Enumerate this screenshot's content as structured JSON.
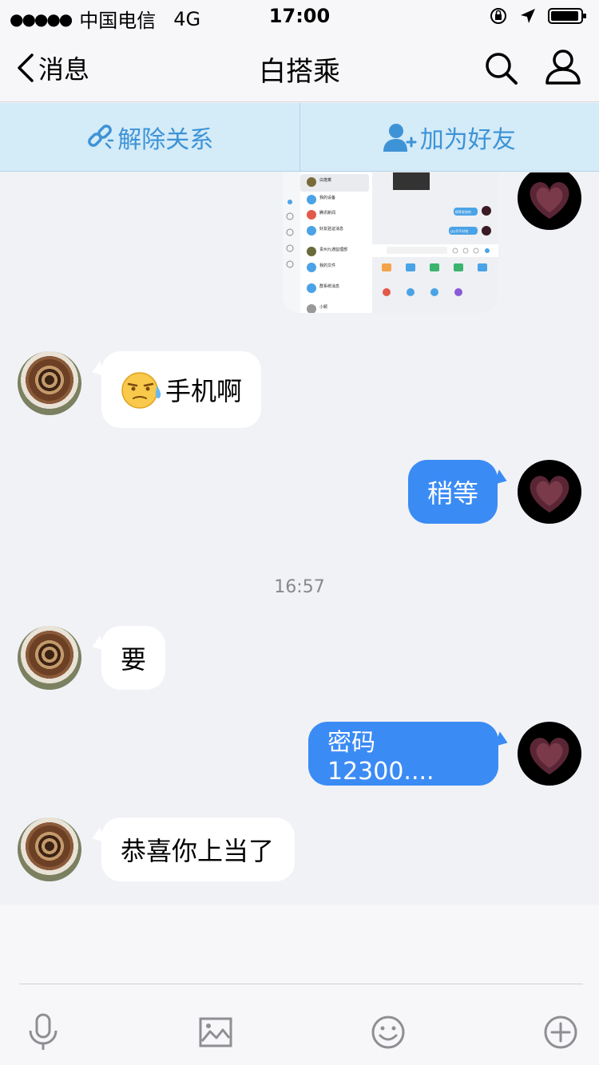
{
  "status_bar": {
    "signal": "●●●●●",
    "carrier": "中国电信",
    "network": "4G",
    "time": "17:00"
  },
  "nav": {
    "back_label": "消息",
    "title": "白搭乘"
  },
  "actions": {
    "unbind_label": "解除关系",
    "add_friend_label": "加为好友"
  },
  "messages": [
    {
      "side": "in",
      "text": "手机啊",
      "emoji": "sweat-emoji"
    },
    {
      "side": "out",
      "text": "稍等"
    },
    {
      "side": "in",
      "text": "要"
    },
    {
      "side": "out",
      "text": "密码12300...."
    },
    {
      "side": "in",
      "text": "恭喜你上当了"
    }
  ],
  "timestamp": "16:57",
  "shared_image": {
    "list_items": [
      "白搭乘",
      "我的设备",
      "腾讯新闻",
      "好友验证消息",
      "贵州九通监理部",
      "我的文件",
      "群系统消息",
      "小颖"
    ],
    "bubble_texts": [
      "稍等发给你",
      "QQ号不对哈"
    ]
  },
  "colors": {
    "accent": "#3b8bf5",
    "action_bar": "#d4ebf8",
    "action_text": "#3d93d6",
    "background": "#f1f2f6"
  }
}
